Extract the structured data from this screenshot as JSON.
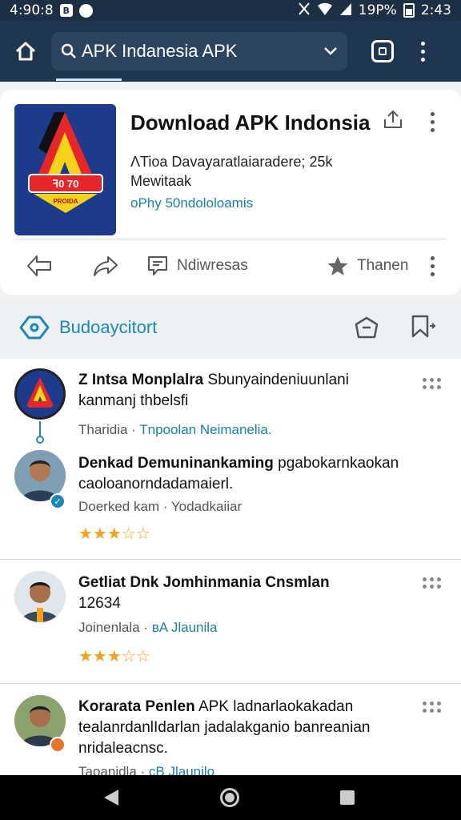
{
  "status_bar": {
    "time_left": "4:90:8",
    "box_icon_text": "B",
    "battery": "19P%",
    "time_right": "2:43"
  },
  "appbar": {
    "search_text": "APK Indanesia APK"
  },
  "app": {
    "title": "Download APK Indonsia",
    "line1": "ΛTioa Davayaratlaiaradere; 25k",
    "line2": "Mewitaak",
    "line3": "oPhy 50ndololoamis",
    "logo_text": "ꟻ0 70",
    "logo_subtext": "PROIDA"
  },
  "actions": {
    "left_label": "Ndiwresas",
    "right_label": "Thanen"
  },
  "section": {
    "title": "Budoaycitort"
  },
  "reviews": [
    {
      "title_bold": "Z Intsa Monplalra",
      "title_rest": " Sbunyaindeniuunlani",
      "title_line2": "kanmanj thbelsﬁ",
      "meta": "Tharidia  ·",
      "meta_link": "Tnpoolan Neimanelia.",
      "stars": "★★★★★"
    },
    {
      "title_bold": "Denkad Demuninankaming",
      "title_rest": " pgabokarnkaokan",
      "title_line2": "caoloanorndadamaierl.",
      "meta": "Doerked kam · Yodadkaiiar",
      "meta_link": "",
      "stars": "★★★☆☆"
    },
    {
      "title_bold": "Getliat Dnk Jomhinmania Cnsmlan",
      "title_rest": "",
      "title_line2": "12634",
      "meta": "Joinenlala  ·",
      "meta_link": "ʙA  Jlaunila",
      "stars": "★★★☆☆"
    },
    {
      "title_bold": "Korarata Penlen",
      "title_rest": " APK ladnarlaokakadan",
      "title_line2": "tealanrdanlIdarlan jadalakganio banreanian",
      "title_line3": "nridaleacnsc.",
      "meta": "Taoanidla  ·",
      "meta_link": "cB  Jlaunilo",
      "stars": ""
    }
  ],
  "colors": {
    "appbar": "#1f3650",
    "accent_link": "#1a7fa8",
    "star": "#f2a21b"
  }
}
